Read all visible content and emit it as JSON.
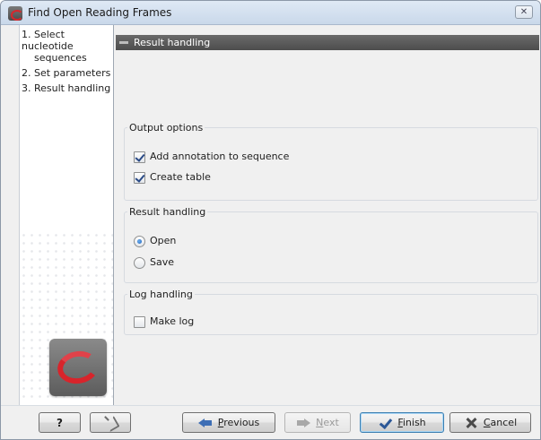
{
  "window": {
    "title": "Find Open Reading Frames",
    "close_glyph": "✕"
  },
  "steps": [
    {
      "number": "1.",
      "label_line1": "Select nucleotide",
      "label_line2": "sequences"
    },
    {
      "number": "2.",
      "label": "Set parameters"
    },
    {
      "number": "3.",
      "label": "Result handling"
    }
  ],
  "panel": {
    "header": "Result handling"
  },
  "output_options": {
    "legend": "Output options",
    "items": [
      {
        "label": "Add annotation to sequence",
        "checked": true
      },
      {
        "label": "Create table",
        "checked": true
      }
    ]
  },
  "result_handling": {
    "legend": "Result handling",
    "items": [
      {
        "label": "Open",
        "selected": true
      },
      {
        "label": "Save",
        "selected": false
      }
    ]
  },
  "log_handling": {
    "legend": "Log handling",
    "items": [
      {
        "label": "Make log",
        "checked": false
      }
    ]
  },
  "buttons": {
    "help": "?",
    "previous_mnemonic": "P",
    "previous_rest": "revious",
    "next_mnemonic": "N",
    "next_rest": "ext",
    "finish_mnemonic": "F",
    "finish_rest": "inish",
    "cancel_mnemonic": "C",
    "cancel_rest": "ancel"
  },
  "icons": {
    "app": "clc-logo-icon",
    "previous": "arrow-left-icon",
    "next": "arrow-right-icon",
    "finish": "checkmark-icon",
    "cancel": "x-icon",
    "reset": "reset-icon"
  },
  "colors": {
    "accent": "#3d6eb5",
    "logo_red": "#d8242b",
    "header_bg": "#5a5a5a"
  }
}
